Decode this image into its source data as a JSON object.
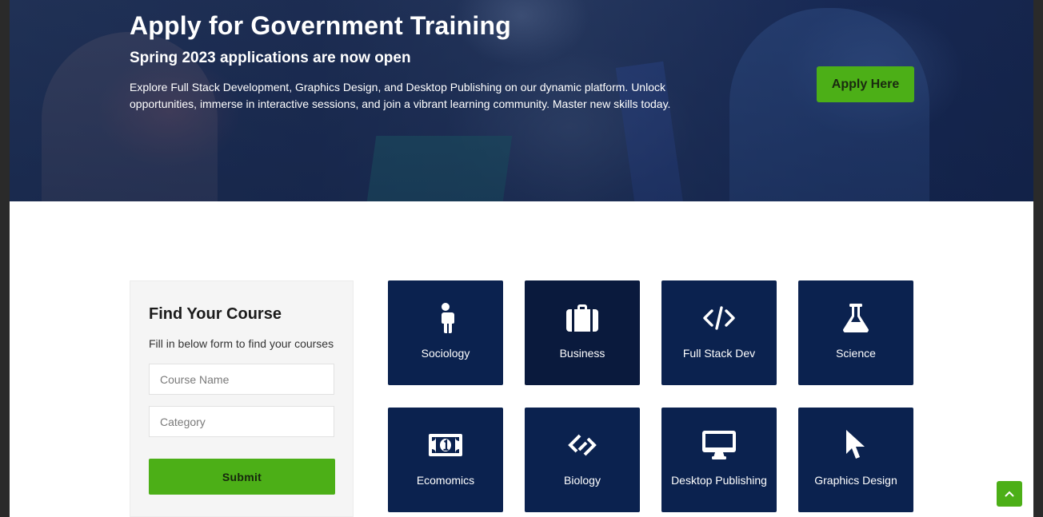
{
  "hero": {
    "title": "Apply for Government Training",
    "subtitle": "Spring 2023 applications are now open",
    "description": "Explore Full Stack Development, Graphics Design, and Desktop Publishing on our dynamic platform. Unlock opportunities, immerse in interactive sessions, and join a vibrant learning community. Master new skills today.",
    "apply_label": "Apply Here"
  },
  "finder": {
    "title": "Find Your Course",
    "subtitle": "Fill in below form to find your courses",
    "course_placeholder": "Course Name",
    "category_placeholder": "Category",
    "submit_label": "Submit"
  },
  "courses": [
    {
      "label": "Sociology",
      "icon": "person-icon"
    },
    {
      "label": "Business",
      "icon": "briefcase-icon"
    },
    {
      "label": "Full Stack Dev",
      "icon": "code-icon"
    },
    {
      "label": "Science",
      "icon": "flask-icon"
    },
    {
      "label": "Ecomomics",
      "icon": "money-bill-icon"
    },
    {
      "label": "Biology",
      "icon": "dna-icon"
    },
    {
      "label": "Desktop Publishing",
      "icon": "desktop-icon"
    },
    {
      "label": "Graphics Design",
      "icon": "mouse-pointer-icon"
    }
  ],
  "colors": {
    "accent_green": "#4caf17",
    "tile_navy": "#0b224f",
    "tile_navy_dark": "#0a1a3d"
  }
}
